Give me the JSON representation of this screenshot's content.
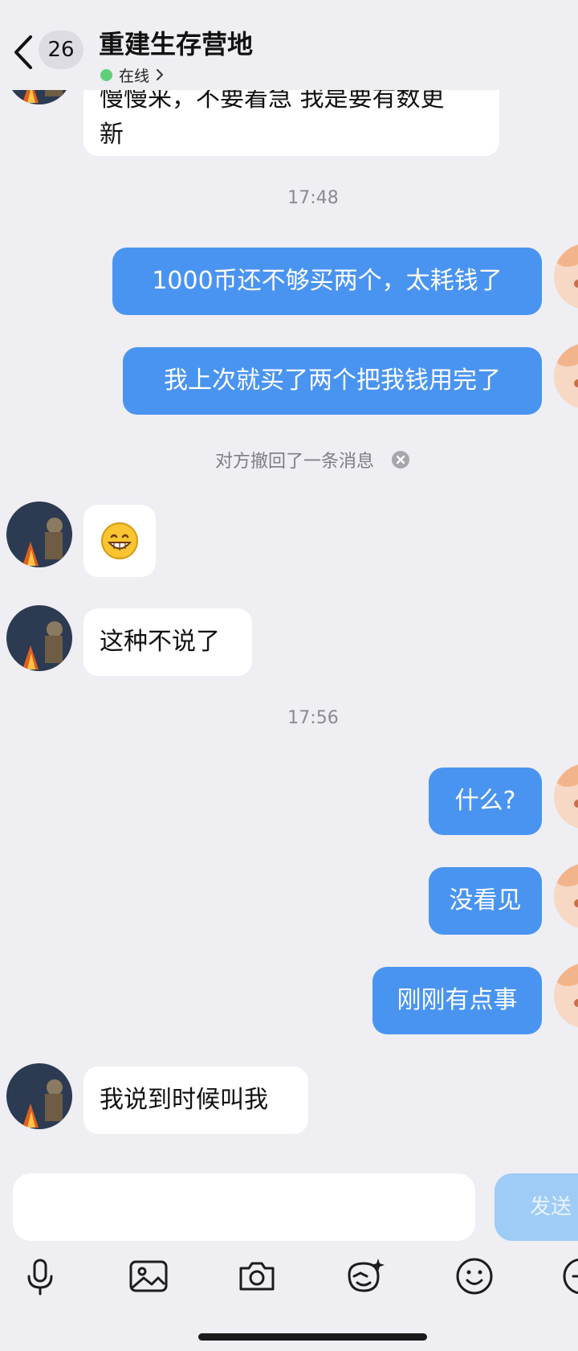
{
  "header": {
    "badge": "26",
    "title": "重建生存营地",
    "status": "在线"
  },
  "messages": {
    "m0_line1": "慢慢来，不要着急 我是要有数更",
    "m0_line2": "新",
    "time1": "17:48",
    "m1": "1000币还不够买两个，太耗钱了",
    "m2": "我上次就买了两个把我钱用完了",
    "recall": "对方撤回了一条消息",
    "m3_emoji": "😁",
    "m4": "这种不说了",
    "time2": "17:56",
    "m5": "什么?",
    "m6": "没看见",
    "m7": "刚刚有点事",
    "m8": "我说到时候叫我"
  },
  "composer": {
    "send_label": "发送",
    "input_value": ""
  },
  "toolbar": {
    "icons": [
      "microphone-icon",
      "image-icon",
      "camera-icon",
      "sticker-icon",
      "emoji-icon",
      "plus-icon"
    ]
  },
  "colors": {
    "background": "#eeeef3",
    "self_bubble": "#4a94f1",
    "other_bubble": "#ffffff",
    "online": "#5fd07a",
    "send_disabled": "#9fccf6"
  }
}
